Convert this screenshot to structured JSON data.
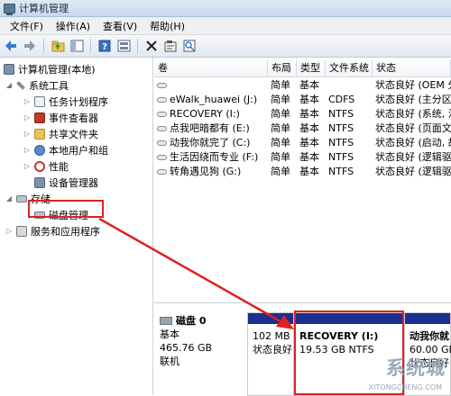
{
  "window": {
    "title": "计算机管理"
  },
  "menu": [
    "文件(F)",
    "操作(A)",
    "查看(V)",
    "帮助(H)"
  ],
  "toolbar": [
    "back-icon",
    "forward-icon",
    "up-folder-icon",
    "show-hide-tree-icon",
    "help-icon",
    "view-icon",
    "delete-icon",
    "properties-icon",
    "query-icon"
  ],
  "tree": {
    "root": "计算机管理(本地)",
    "system_tools": "系统工具",
    "task_scheduler": "任务计划程序",
    "event_viewer": "事件查看器",
    "shared_folders": "共享文件夹",
    "local_users": "本地用户和组",
    "performance": "性能",
    "device_manager": "设备管理器",
    "storage": "存储",
    "disk_management": "磁盘管理",
    "services_apps": "服务和应用程序"
  },
  "columns": [
    "卷",
    "布局",
    "类型",
    "文件系统",
    "状态"
  ],
  "volumes": [
    {
      "name": "",
      "layout": "简单",
      "type": "基本",
      "fs": "",
      "status": "状态良好 (OEM 分"
    },
    {
      "name": "eWalk_huawei (J:)",
      "layout": "简单",
      "type": "基本",
      "fs": "CDFS",
      "status": "状态良好 (主分区)"
    },
    {
      "name": "RECOVERY (I:)",
      "layout": "简单",
      "type": "基本",
      "fs": "NTFS",
      "status": "状态良好 (系统, 活"
    },
    {
      "name": "点我吧暗都有 (E:)",
      "layout": "简单",
      "type": "基本",
      "fs": "NTFS",
      "status": "状态良好 (页面文件"
    },
    {
      "name": "动我你就完了 (C:)",
      "layout": "简单",
      "type": "基本",
      "fs": "NTFS",
      "status": "状态良好 (启动, 故"
    },
    {
      "name": "生活因绕而专业 (F:)",
      "layout": "简单",
      "type": "基本",
      "fs": "NTFS",
      "status": "状态良好 (逻辑驱"
    },
    {
      "name": "转角遇见狗 (G:)",
      "layout": "简单",
      "type": "基本",
      "fs": "NTFS",
      "status": "状态良好 (逻辑驱"
    }
  ],
  "disk": {
    "name": "磁盘 0",
    "kind": "基本",
    "size": "465.76 GB",
    "state": "联机",
    "partitions": [
      {
        "line1": "",
        "line2": "102 MB",
        "line3": "状态良好"
      },
      {
        "line1": "RECOVERY  (I:)",
        "line2": "19.53 GB NTFS",
        "line3": ""
      },
      {
        "line1": "动我你就",
        "line2": "60.00 GB",
        "line3": "状态良好"
      }
    ]
  },
  "watermark": {
    "text": "系统城",
    "sub": "XITONGCHENG.COM"
  },
  "colors": {
    "partition_bar": "#1a2f8f",
    "highlight": "#e02020"
  }
}
